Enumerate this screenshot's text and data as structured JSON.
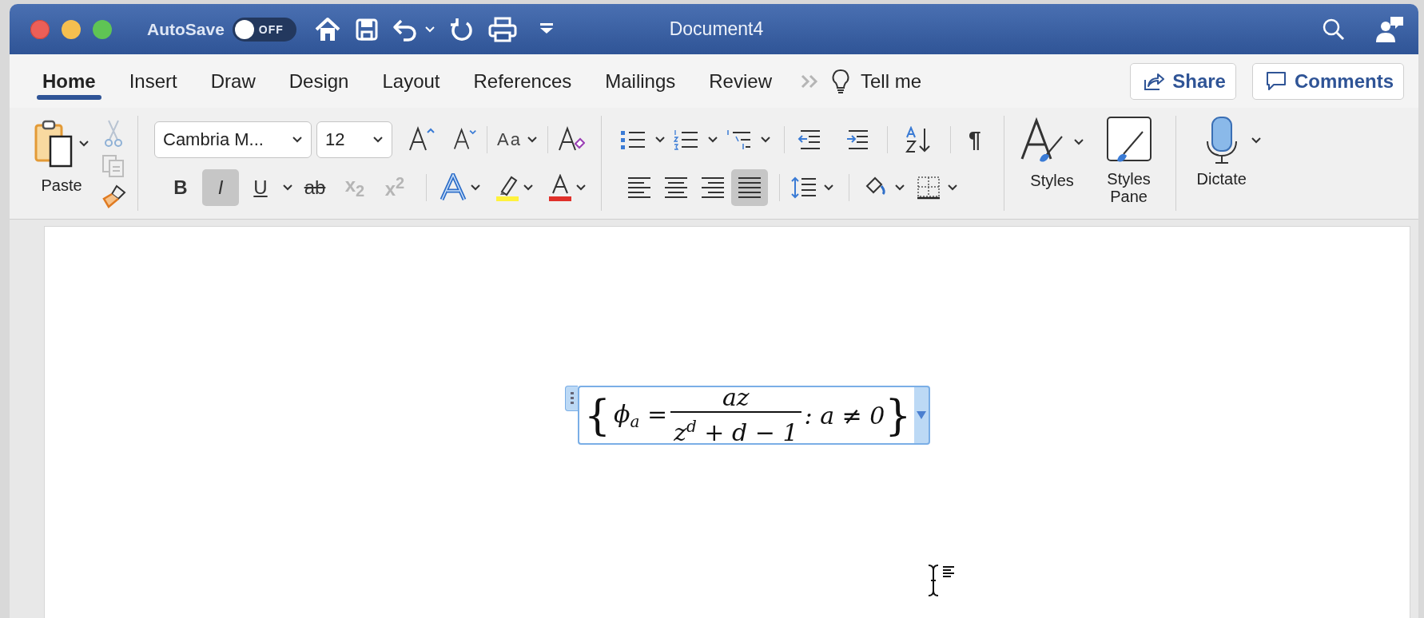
{
  "window": {
    "title": "Document4"
  },
  "autosave": {
    "label": "AutoSave",
    "on": false,
    "state": "OFF"
  },
  "tabs": [
    {
      "label": "Home",
      "selected": true
    },
    {
      "label": "Insert",
      "selected": false
    },
    {
      "label": "Draw",
      "selected": false
    },
    {
      "label": "Design",
      "selected": false
    },
    {
      "label": "Layout",
      "selected": false
    },
    {
      "label": "References",
      "selected": false
    },
    {
      "label": "Mailings",
      "selected": false
    },
    {
      "label": "Review",
      "selected": false
    }
  ],
  "tell_me": "Tell me",
  "share": "Share",
  "comments": "Comments",
  "ribbon": {
    "paste": "Paste",
    "font_name": "Cambria M...",
    "font_size": "12",
    "change_case": "Aa",
    "format_buttons": [
      {
        "kind": "bold",
        "label": "B",
        "on": false,
        "disabled": false
      },
      {
        "kind": "italic",
        "label": "I",
        "on": true,
        "disabled": false
      },
      {
        "kind": "underline",
        "label": "U",
        "on": false,
        "disabled": false
      },
      {
        "kind": "strikethrough",
        "label": "ab",
        "on": false,
        "disabled": false
      },
      {
        "kind": "subscript",
        "label": "x$_{2}$",
        "on": false,
        "disabled": true
      },
      {
        "kind": "superscript",
        "label": "x$^{2}$",
        "on": false,
        "disabled": true
      }
    ],
    "alignments": [
      {
        "kind": "left",
        "selected": false
      },
      {
        "kind": "center",
        "selected": false
      },
      {
        "kind": "right",
        "selected": false
      },
      {
        "kind": "justify",
        "selected": true
      }
    ],
    "pilcrow": "¶",
    "styles": "Styles",
    "styles_pane": "Styles Pane",
    "dictate": "Dictate"
  },
  "equation": {
    "open": "{",
    "lhs": "ϕ$_{a}$ =",
    "numerator": "az",
    "denominator": "z$^{d}$ + d − 1",
    "condition": ": a ≠ 0",
    "close": "}"
  }
}
